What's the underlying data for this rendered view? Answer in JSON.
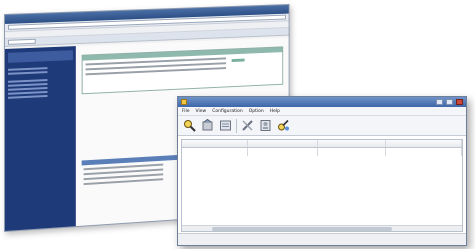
{
  "browser": {
    "sidebar": {
      "headings": [
        "",
        ""
      ]
    },
    "main": {
      "heading_lines": [
        "",
        ""
      ],
      "subsection_title": ""
    }
  },
  "app": {
    "title": "",
    "menu": [
      "File",
      "View",
      "Configuration",
      "Option",
      "Help"
    ],
    "toolbar_icons": [
      "search-icon",
      "settings-icon",
      "network-icon",
      "tools-icon",
      "device-icon",
      "browser-icon"
    ],
    "columns": [
      "",
      "",
      "",
      ""
    ],
    "rows": [
      [
        "",
        "",
        "",
        ""
      ]
    ],
    "status": "",
    "accent": "#3e66a8"
  }
}
